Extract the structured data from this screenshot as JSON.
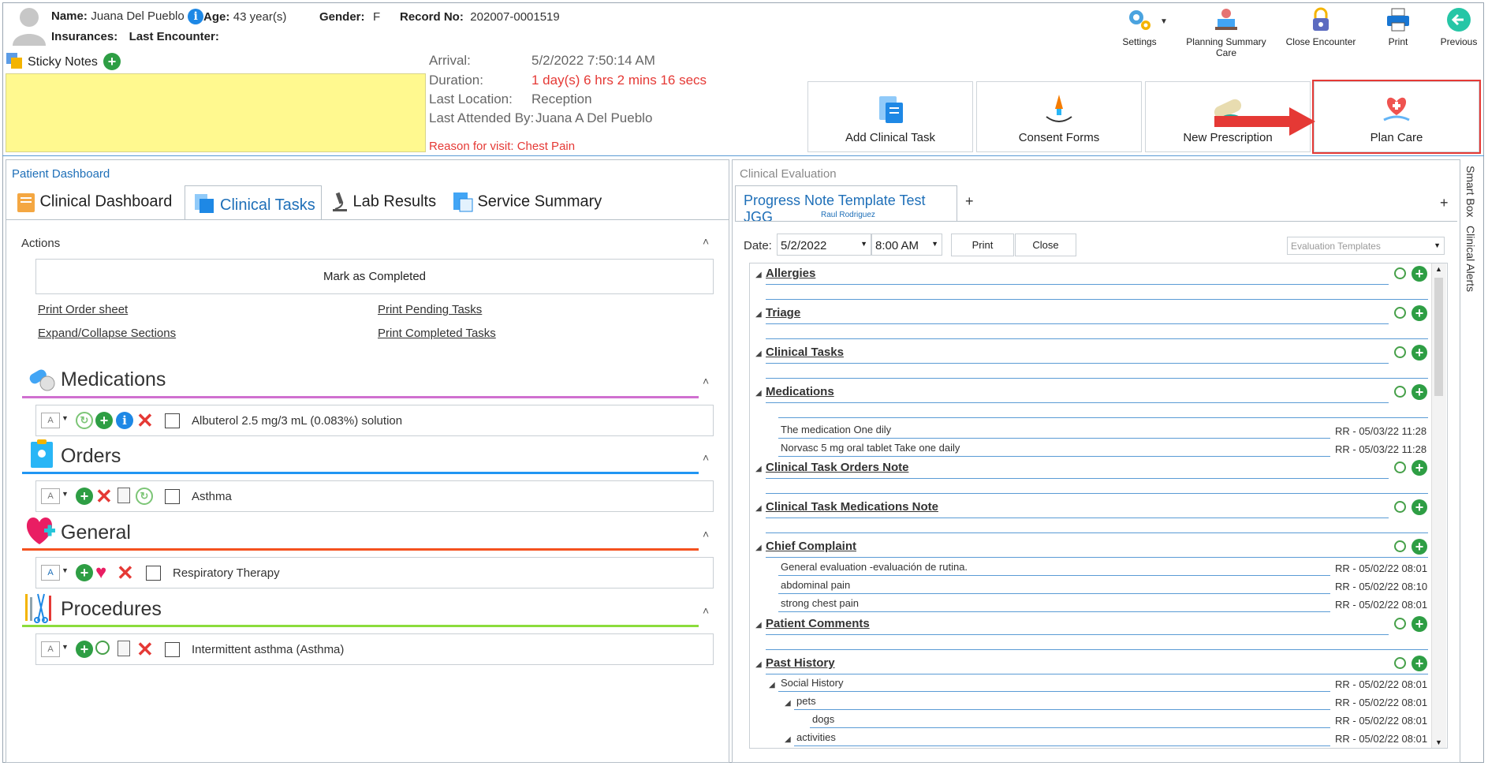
{
  "patient": {
    "name_label": "Name:",
    "name": "Juana Del Pueblo",
    "age_label": "Age:",
    "age": "43 year(s)",
    "gender_label": "Gender:",
    "gender": "F",
    "record_label": "Record No:",
    "record": "202007-0001519",
    "insurances_label": "Insurances:",
    "last_encounter_label": "Last Encounter:"
  },
  "toolbar": {
    "settings": "Settings",
    "planning": "Planning Summary Care",
    "close_encounter": "Close Encounter",
    "print": "Print",
    "previous": "Previous"
  },
  "sticky_notes": "Sticky Notes",
  "visit": {
    "arrival_label": "Arrival:",
    "arrival": "5/2/2022 7:50:14 AM",
    "duration_label": "Duration:",
    "duration": "1 day(s) 6 hrs 2 mins 16 secs",
    "location_label": "Last Location:",
    "location": "Reception",
    "attended_label": "Last Attended By:",
    "attended": "Juana A Del Pueblo",
    "reason": "Reason for visit: Chest Pain"
  },
  "actions_buttons": {
    "add_clinical_task": "Add Clinical Task",
    "consent_forms": "Consent Forms",
    "new_prescription": "New Prescription",
    "plan_care": "Plan Care"
  },
  "dashboard": {
    "title": "Patient Dashboard",
    "tabs": [
      "Clinical Dashboard",
      "Clinical Tasks",
      "Lab Results",
      "Service Summary"
    ],
    "actions_label": "Actions",
    "mark_completed": "Mark as Completed",
    "links": {
      "print_order": "Print Order sheet",
      "print_pending": "Print Pending Tasks",
      "expand_collapse": "Expand/Collapse Sections",
      "print_completed": "Print Completed Tasks"
    },
    "sections": [
      {
        "title": "Medications",
        "item": "Albuterol 2.5 mg/3 mL (0.083%) solution",
        "color": "#d070d0"
      },
      {
        "title": "Orders",
        "item": "Asthma",
        "color": "#2196f3"
      },
      {
        "title": "General",
        "item": "Respiratory Therapy",
        "color": "#f4511e"
      },
      {
        "title": "Procedures",
        "item": "Intermittent asthma (Asthma)",
        "color": "#8bdc3c"
      }
    ]
  },
  "evaluation": {
    "title": "Clinical Evaluation",
    "tab_title": "Progress Note Template Test JGG",
    "tab_author": "Raul Rodriguez",
    "side_tabs": [
      "Smart Box",
      "Clinical Alerts"
    ],
    "date_label": "Date:",
    "date": "5/2/2022",
    "time": "8:00 AM",
    "print": "Print",
    "close": "Close",
    "templates_placeholder": "Evaluation Templates",
    "sections": [
      "Allergies",
      "Triage",
      "Clinical Tasks",
      "Medications",
      "Clinical Task Orders Note",
      "Clinical Task Medications Note",
      "Chief Complaint",
      "Patient Comments",
      "Past History"
    ],
    "medication_entries": [
      {
        "text": "The medication One dily",
        "meta": "RR - 05/03/22 11:28"
      },
      {
        "text": "Norvasc 5 mg oral tablet Take one daily",
        "meta": "RR - 05/03/22 11:28"
      }
    ],
    "complaint_entries": [
      {
        "text": "General evaluation -evaluación de rutina.",
        "meta": "RR - 05/02/22 08:01"
      },
      {
        "text": "abdominal pain",
        "meta": "RR - 05/02/22 08:10"
      },
      {
        "text": "strong chest pain",
        "meta": "RR - 05/02/22 08:01"
      }
    ],
    "history_entries": [
      {
        "text": "Social History",
        "meta": "RR - 05/02/22 08:01"
      },
      {
        "text": "pets",
        "meta": "RR - 05/02/22 08:01"
      },
      {
        "text": "dogs",
        "meta": "RR - 05/02/22 08:01"
      },
      {
        "text": "activities",
        "meta": "RR - 05/02/22 08:01"
      }
    ]
  }
}
